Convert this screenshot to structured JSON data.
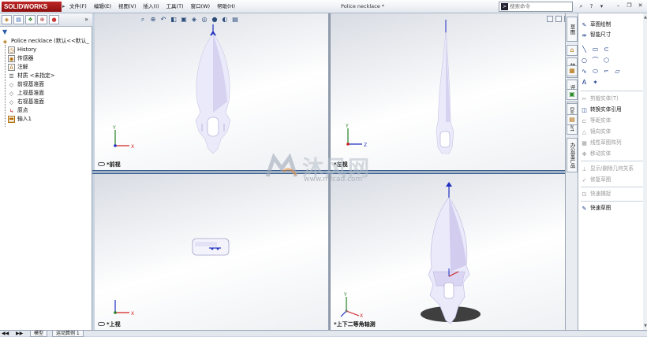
{
  "app": {
    "logo_text": "SOLIDWORKS",
    "document_title": "Police necklace *",
    "menus": [
      "文件(F)",
      "编辑(E)",
      "视图(V)",
      "插入(I)",
      "工具(T)",
      "窗口(W)",
      "帮助(H)"
    ],
    "search_placeholder": "搜索命令"
  },
  "feature_tree": {
    "root": "Police necklace  (默认<<默认_",
    "items": [
      {
        "label": "History",
        "icon": "history-icon"
      },
      {
        "label": "传感器",
        "icon": "sensor-icon"
      },
      {
        "label": "注解",
        "icon": "annotation-icon"
      },
      {
        "label": "材质 <未指定>",
        "icon": "material-icon"
      },
      {
        "label": "前视基准面",
        "icon": "plane-icon"
      },
      {
        "label": "上视基准面",
        "icon": "plane-icon"
      },
      {
        "label": "右视基准面",
        "icon": "plane-icon"
      },
      {
        "label": "原点",
        "icon": "origin-icon"
      },
      {
        "label": "输入1",
        "icon": "import-icon"
      }
    ]
  },
  "viewports": {
    "front_label": "*前视",
    "left_label": "*左视",
    "top_label": "*上视",
    "iso_label": "*上下二等角轴测"
  },
  "triad": {
    "x": "X",
    "y": "Y",
    "z": "Z"
  },
  "right_tabs": [
    "草图",
    "特征",
    "评估",
    "DimXpert",
    "办公室产品"
  ],
  "sketch_panel": {
    "items": [
      {
        "label": "草图绘制",
        "enabled": true
      },
      {
        "label": "智能尺寸",
        "enabled": true
      },
      {
        "label": "剪裁实体(T)",
        "enabled": false
      },
      {
        "label": "转换实体引用",
        "enabled": true
      },
      {
        "label": "等距实体",
        "enabled": false
      },
      {
        "label": "镜向实体",
        "enabled": false
      },
      {
        "label": "线性草图阵列",
        "enabled": false
      },
      {
        "label": "移动实体",
        "enabled": false
      },
      {
        "label": "显示/删除几何关系",
        "enabled": false
      },
      {
        "label": "修复草图",
        "enabled": false
      },
      {
        "label": "快速捕捉",
        "enabled": false
      },
      {
        "label": "快速草图",
        "enabled": true
      }
    ]
  },
  "bottom_tabs": [
    "模型",
    "运动算例 1"
  ],
  "watermark": {
    "text": "沐风网",
    "url": "www.mfcad.com"
  },
  "colors": {
    "accent": "#1d3e8f",
    "part": "#e8e8f8",
    "axis_x": "#d02020",
    "axis_y": "#208020",
    "axis_z": "#2030c0"
  }
}
